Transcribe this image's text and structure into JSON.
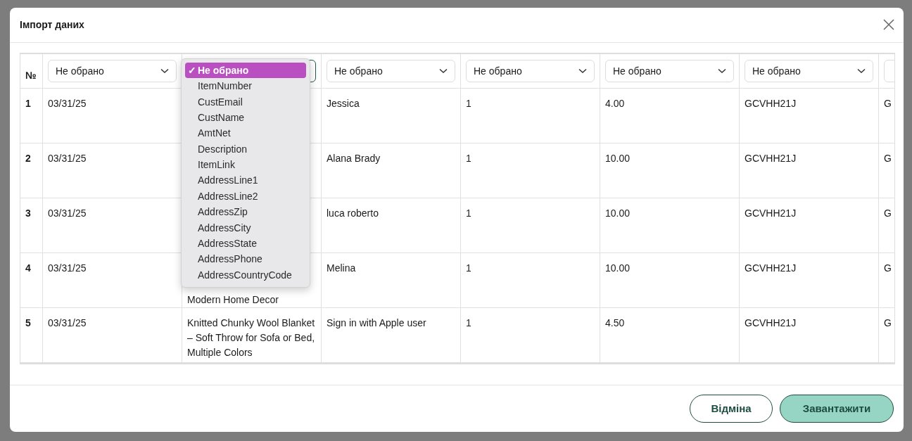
{
  "dialog": {
    "title": "Імпорт даних"
  },
  "table": {
    "number_header": "№",
    "columns": [
      {
        "value": "Не обрано",
        "focused": false
      },
      {
        "focused": true
      },
      {
        "value": "Не обрано",
        "focused": false
      },
      {
        "value": "Не обрано",
        "focused": false
      },
      {
        "value": "Не обрано",
        "focused": false
      },
      {
        "value": "Не обрано",
        "focused": false
      },
      {
        "focused": false
      }
    ],
    "rows": [
      {
        "number": "1",
        "cells": [
          {
            "text": "03/31/25"
          },
          null,
          {
            "text": "Jessica"
          },
          {
            "text": "1"
          },
          {
            "text": "4.00"
          },
          {
            "text": "GCVHH21J"
          },
          {
            "text": "G"
          }
        ]
      },
      {
        "number": "2",
        "cells": [
          {
            "text": "03/31/25"
          },
          null,
          {
            "text": "Alana Brady"
          },
          {
            "text": "1"
          },
          {
            "text": "10.00"
          },
          {
            "text": "GCVHH21J"
          },
          {
            "text": "G"
          }
        ]
      },
      {
        "number": "3",
        "cells": [
          {
            "text": "03/31/25"
          },
          null,
          {
            "text": "luca roberto"
          },
          {
            "text": "1"
          },
          {
            "text": "10.00"
          },
          {
            "text": "GCVHH21J"
          },
          {
            "text": "G"
          }
        ]
      },
      {
        "number": "4",
        "cells": [
          {
            "text": "03/31/25"
          },
          {
            "text": "Modern Home Decor",
            "kind": "tail"
          },
          {
            "text": "Melina"
          },
          {
            "text": "1"
          },
          {
            "text": "10.00"
          },
          {
            "text": "GCVHH21J"
          },
          {
            "text": "G"
          }
        ]
      },
      {
        "number": "5",
        "cells": [
          {
            "text": "03/31/25"
          },
          {
            "text": "Knitted Chunky Wool Blanket – Soft Throw for Sofa or Bed, Multiple Colors"
          },
          {
            "text": "Sign in with Apple user"
          },
          {
            "text": "1"
          },
          {
            "text": "4.50"
          },
          {
            "text": "GCVHH21J"
          },
          {
            "text": "G"
          }
        ]
      }
    ]
  },
  "dropdown": {
    "check_mark": "✓",
    "options": [
      {
        "label": "Не обрано",
        "selected": true
      },
      {
        "label": "ItemNumber",
        "selected": false
      },
      {
        "label": "CustEmail",
        "selected": false
      },
      {
        "label": "CustName",
        "selected": false
      },
      {
        "label": "AmtNet",
        "selected": false
      },
      {
        "label": "Description",
        "selected": false
      },
      {
        "label": "ItemLink",
        "selected": false
      },
      {
        "label": "AddressLine1",
        "selected": false
      },
      {
        "label": "AddressLine2",
        "selected": false
      },
      {
        "label": "AddressZip",
        "selected": false
      },
      {
        "label": "AddressCity",
        "selected": false
      },
      {
        "label": "AddressState",
        "selected": false
      },
      {
        "label": "AddressPhone",
        "selected": false
      },
      {
        "label": "AddressCountryCode",
        "selected": false
      }
    ]
  },
  "buttons": [
    {
      "label": "Відміна",
      "kind": "secondary"
    },
    {
      "label": "Завантажити",
      "kind": "primary"
    }
  ]
}
